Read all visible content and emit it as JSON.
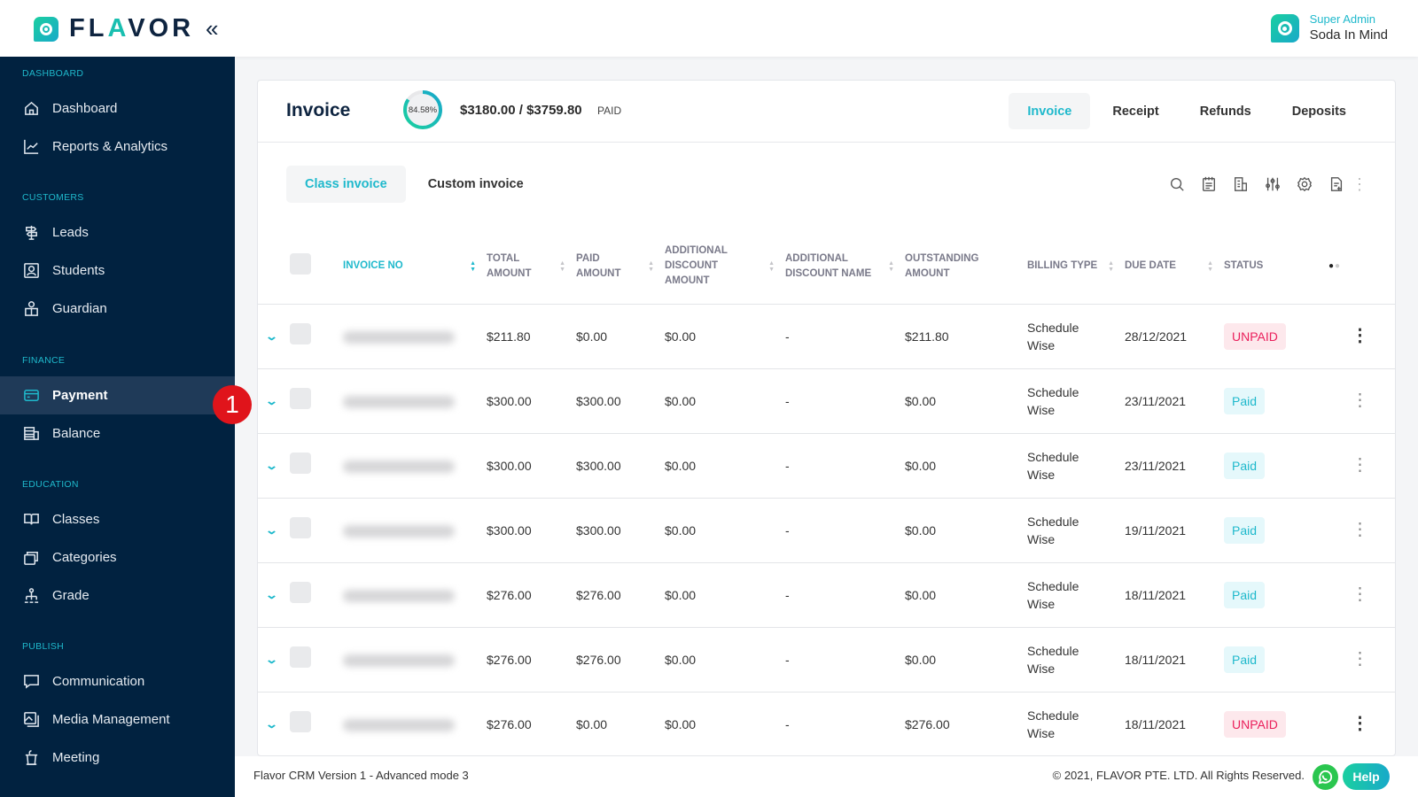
{
  "app": {
    "brand_prefix": "FL",
    "brand_accent": "A",
    "brand_suffix": "VOR",
    "collapse_icon": "«"
  },
  "user": {
    "role": "Super Admin",
    "name": "Soda In Mind"
  },
  "sidebar": {
    "sections": [
      {
        "label": "DASHBOARD",
        "items": [
          {
            "label": "Dashboard",
            "icon": "home-icon"
          },
          {
            "label": "Reports & Analytics",
            "icon": "chart-line-icon"
          }
        ]
      },
      {
        "label": "CUSTOMERS",
        "items": [
          {
            "label": "Leads",
            "icon": "signpost-icon"
          },
          {
            "label": "Students",
            "icon": "user-square-icon"
          },
          {
            "label": "Guardian",
            "icon": "guardian-icon"
          }
        ]
      },
      {
        "label": "FINANCE",
        "items": [
          {
            "label": "Payment",
            "icon": "credit-card-icon",
            "active": true
          },
          {
            "label": "Balance",
            "icon": "balance-icon"
          }
        ]
      },
      {
        "label": "EDUCATION",
        "items": [
          {
            "label": "Classes",
            "icon": "book-icon"
          },
          {
            "label": "Categories",
            "icon": "stack-icon"
          },
          {
            "label": "Grade",
            "icon": "hierarchy-icon"
          }
        ]
      },
      {
        "label": "PUBLISH",
        "items": [
          {
            "label": "Communication",
            "icon": "message-icon"
          },
          {
            "label": "Media Management",
            "icon": "image-icon"
          },
          {
            "label": "Meeting",
            "icon": "podium-icon"
          }
        ]
      }
    ],
    "annotation_badge": "1"
  },
  "invoice_header": {
    "title": "Invoice",
    "progress_percent": 84.58,
    "progress_label": "84.58%",
    "amount": "$3180.00 / $3759.80",
    "paid_label": "PAID",
    "tabs": [
      {
        "label": "Invoice",
        "active": true
      },
      {
        "label": "Receipt"
      },
      {
        "label": "Refunds"
      },
      {
        "label": "Deposits"
      }
    ]
  },
  "sub_tabs": [
    {
      "label": "Class invoice",
      "active": true
    },
    {
      "label": "Custom invoice"
    }
  ],
  "toolbar": [
    "search-icon",
    "calendar-icon",
    "report-icon",
    "filter-sliders-icon",
    "gear-icon",
    "export-file-icon",
    "more-vertical-icon"
  ],
  "table": {
    "columns": [
      "INVOICE NO",
      "TOTAL AMOUNT",
      "PAID AMOUNT",
      "ADDITIONAL DISCOUNT AMOUNT",
      "ADDITIONAL DISCOUNT NAME",
      "OUTSTANDING AMOUNT",
      "BILLING TYPE",
      "DUE DATE",
      "STATUS"
    ],
    "rows": [
      {
        "total": "$211.80",
        "paid": "$0.00",
        "disc_amt": "$0.00",
        "disc_name": "-",
        "outstanding": "$211.80",
        "billing1": "Schedule",
        "billing2": "Wise",
        "due": "28/12/2021",
        "status": "UNPAID"
      },
      {
        "total": "$300.00",
        "paid": "$300.00",
        "disc_amt": "$0.00",
        "disc_name": "-",
        "outstanding": "$0.00",
        "billing1": "Schedule",
        "billing2": "Wise",
        "due": "23/11/2021",
        "status": "Paid"
      },
      {
        "total": "$300.00",
        "paid": "$300.00",
        "disc_amt": "$0.00",
        "disc_name": "-",
        "outstanding": "$0.00",
        "billing1": "Schedule",
        "billing2": "Wise",
        "due": "23/11/2021",
        "status": "Paid"
      },
      {
        "total": "$300.00",
        "paid": "$300.00",
        "disc_amt": "$0.00",
        "disc_name": "-",
        "outstanding": "$0.00",
        "billing1": "Schedule",
        "billing2": "Wise",
        "due": "19/11/2021",
        "status": "Paid"
      },
      {
        "total": "$276.00",
        "paid": "$276.00",
        "disc_amt": "$0.00",
        "disc_name": "-",
        "outstanding": "$0.00",
        "billing1": "Schedule",
        "billing2": "Wise",
        "due": "18/11/2021",
        "status": "Paid"
      },
      {
        "total": "$276.00",
        "paid": "$276.00",
        "disc_amt": "$0.00",
        "disc_name": "-",
        "outstanding": "$0.00",
        "billing1": "Schedule",
        "billing2": "Wise",
        "due": "18/11/2021",
        "status": "Paid"
      },
      {
        "total": "$276.00",
        "paid": "$0.00",
        "disc_amt": "$0.00",
        "disc_name": "-",
        "outstanding": "$276.00",
        "billing1": "Schedule",
        "billing2": "Wise",
        "due": "18/11/2021",
        "status": "UNPAID"
      }
    ]
  },
  "footer": {
    "version": "Flavor CRM Version 1 - Advanced mode 3",
    "copyright": "© 2021, FLAVOR PTE. LTD. All Rights Reserved.",
    "help": "Help"
  },
  "colors": {
    "accent": "#1fb9cc",
    "sidebar_bg": "#012240",
    "unpaid": "#ea1f5b",
    "whatsapp": "#2ac64f"
  }
}
